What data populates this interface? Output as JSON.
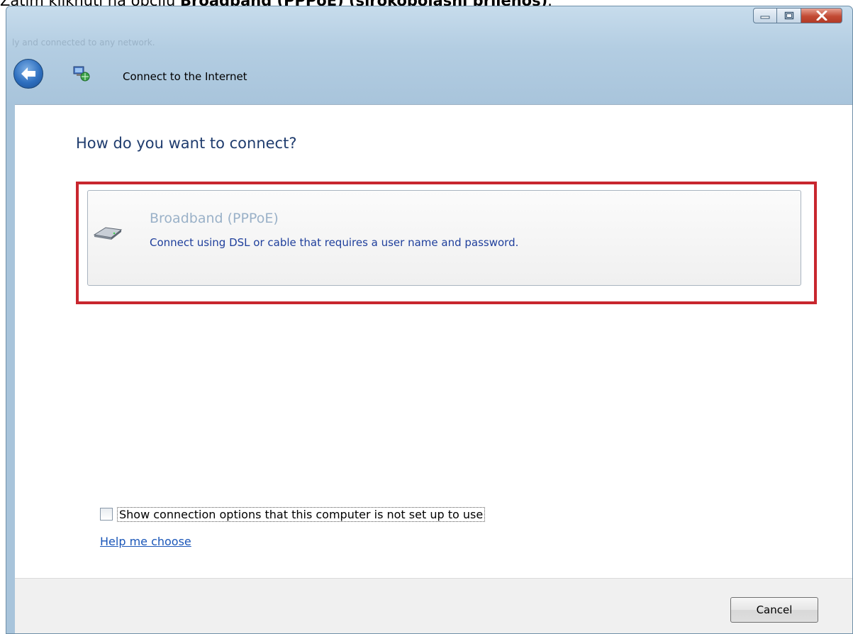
{
  "page_caption": {
    "prefix": "Zatim kliknuti na opciju ",
    "bold": "Broadband (PPPoE) (širokopojasni prijenos)",
    "suffix": "."
  },
  "window": {
    "background_title_ghost": "ly and connected to any network.",
    "title": "Connect to the Internet"
  },
  "main": {
    "heading": "How do you want to connect?",
    "option": {
      "title": "Broadband (PPPoE)",
      "description": "Connect using DSL or cable that requires a user name and password."
    },
    "show_options_checkbox": {
      "label": "Show connection options that this computer is not set up to use",
      "checked": false
    },
    "help_link": "Help me choose"
  },
  "footer": {
    "cancel_label": "Cancel"
  },
  "colors": {
    "highlight_border": "#c8262e",
    "heading": "#1f3c6e",
    "option_title": "#9ab1c8",
    "option_desc": "#1f3f9c",
    "link": "#1a56b8"
  },
  "icons": {
    "back": "back-arrow-icon",
    "wizard": "network-wizard-icon",
    "option": "broadband-modem-icon",
    "minimize": "minimize-icon",
    "maximize": "maximize-icon",
    "close": "close-icon"
  }
}
